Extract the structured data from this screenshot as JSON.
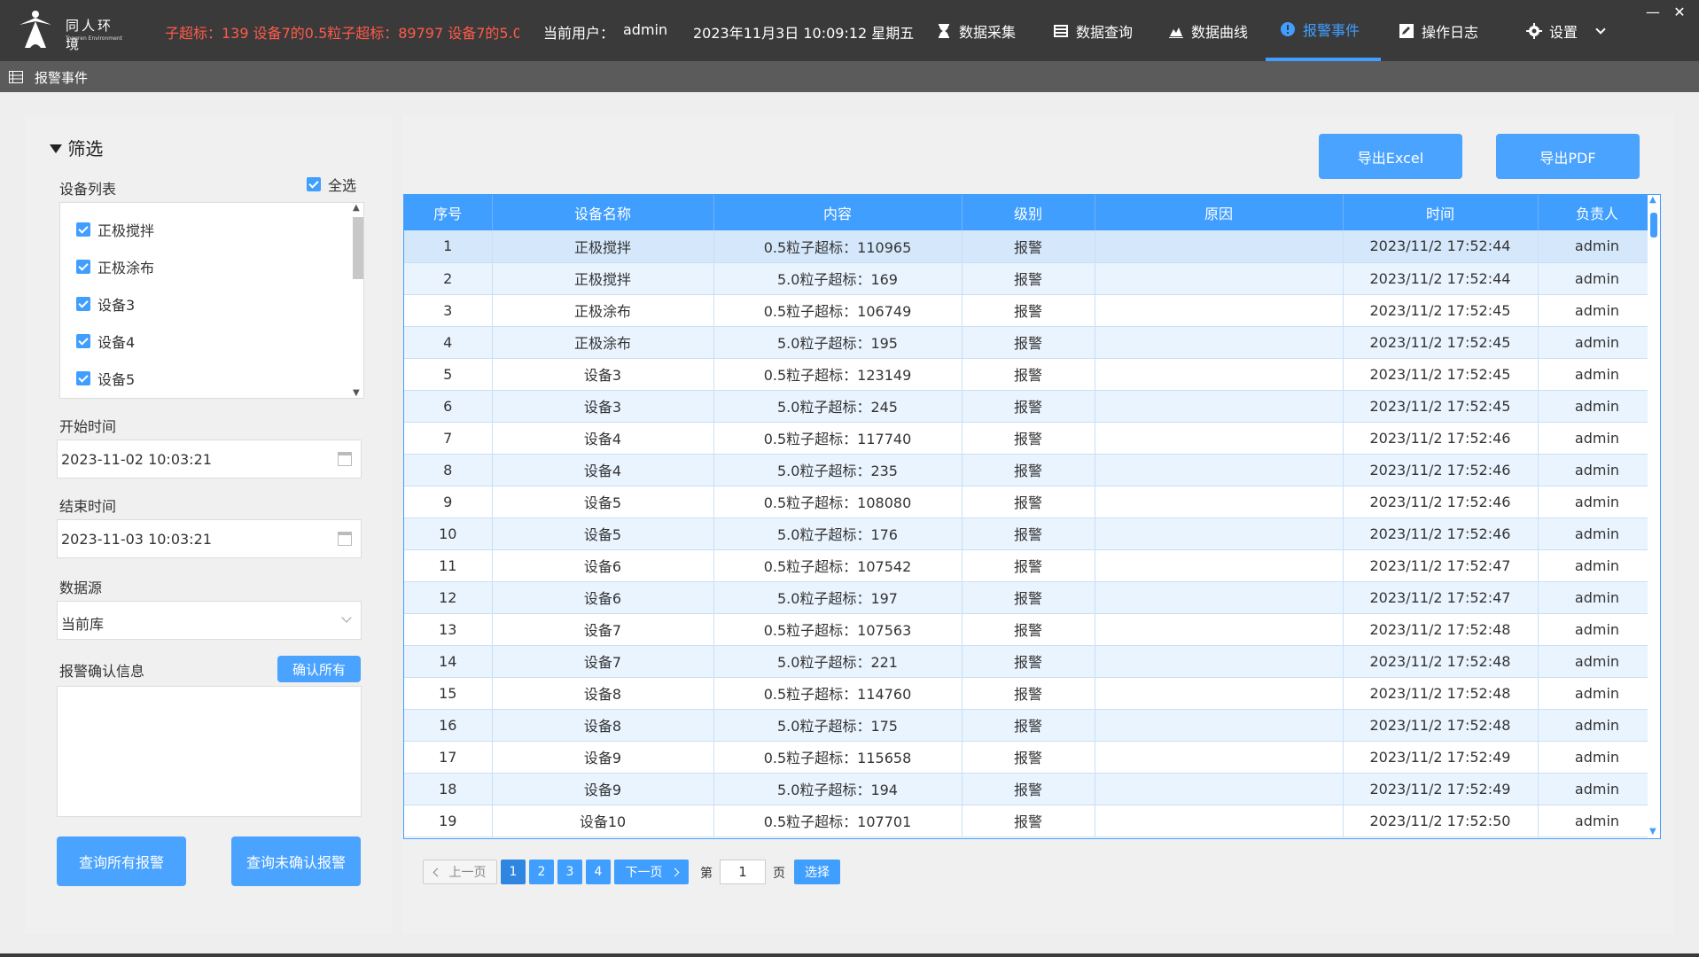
{
  "app": {
    "logo_cn": "同人环境",
    "logo_en": "Tongren Environment"
  },
  "topbar": {
    "ticker": "子超标：139   设备7的0.5粒子超标：89797   设备7的5.0",
    "user_label": "当前用户：",
    "user_name": "admin",
    "datetime": "2023年11月3日 10:09:12 星期五",
    "nav": [
      {
        "label": "数据采集",
        "icon": "hourglass-icon"
      },
      {
        "label": "数据查询",
        "icon": "table-icon"
      },
      {
        "label": "数据曲线",
        "icon": "area-chart-icon"
      },
      {
        "label": "报警事件",
        "icon": "alert-circle-icon"
      },
      {
        "label": "操作日志",
        "icon": "edit-icon"
      },
      {
        "label": "设置",
        "icon": "gear-icon"
      }
    ],
    "minimize": "—",
    "close": "✕"
  },
  "subbar": {
    "title": "报警事件"
  },
  "filter": {
    "title": "筛选",
    "device_list_label": "设备列表",
    "select_all": "全选",
    "devices": [
      "正极搅拌",
      "正极涂布",
      "设备3",
      "设备4",
      "设备5"
    ],
    "start_label": "开始时间",
    "start_value": "2023-11-02 10:03:21",
    "end_label": "结束时间",
    "end_value": "2023-11-03 10:03:21",
    "source_label": "数据源",
    "source_value": "当前库",
    "confirm_label": "报警确认信息",
    "confirm_all": "确认所有",
    "query_all": "查询所有报警",
    "query_unconfirmed": "查询未确认报警"
  },
  "actions": {
    "export_excel": "导出Excel",
    "export_pdf": "导出PDF"
  },
  "table": {
    "columns": [
      "序号",
      "设备名称",
      "内容",
      "级别",
      "原因",
      "时间",
      "负责人"
    ],
    "rows": [
      [
        "1",
        "正极搅拌",
        "0.5粒子超标：110965",
        "报警",
        "",
        "2023/11/2 17:52:44",
        "admin"
      ],
      [
        "2",
        "正极搅拌",
        "5.0粒子超标：169",
        "报警",
        "",
        "2023/11/2 17:52:44",
        "admin"
      ],
      [
        "3",
        "正极涂布",
        "0.5粒子超标：106749",
        "报警",
        "",
        "2023/11/2 17:52:45",
        "admin"
      ],
      [
        "4",
        "正极涂布",
        "5.0粒子超标：195",
        "报警",
        "",
        "2023/11/2 17:52:45",
        "admin"
      ],
      [
        "5",
        "设备3",
        "0.5粒子超标：123149",
        "报警",
        "",
        "2023/11/2 17:52:45",
        "admin"
      ],
      [
        "6",
        "设备3",
        "5.0粒子超标：245",
        "报警",
        "",
        "2023/11/2 17:52:45",
        "admin"
      ],
      [
        "7",
        "设备4",
        "0.5粒子超标：117740",
        "报警",
        "",
        "2023/11/2 17:52:46",
        "admin"
      ],
      [
        "8",
        "设备4",
        "5.0粒子超标：235",
        "报警",
        "",
        "2023/11/2 17:52:46",
        "admin"
      ],
      [
        "9",
        "设备5",
        "0.5粒子超标：108080",
        "报警",
        "",
        "2023/11/2 17:52:46",
        "admin"
      ],
      [
        "10",
        "设备5",
        "5.0粒子超标：176",
        "报警",
        "",
        "2023/11/2 17:52:46",
        "admin"
      ],
      [
        "11",
        "设备6",
        "0.5粒子超标：107542",
        "报警",
        "",
        "2023/11/2 17:52:47",
        "admin"
      ],
      [
        "12",
        "设备6",
        "5.0粒子超标：197",
        "报警",
        "",
        "2023/11/2 17:52:47",
        "admin"
      ],
      [
        "13",
        "设备7",
        "0.5粒子超标：107563",
        "报警",
        "",
        "2023/11/2 17:52:48",
        "admin"
      ],
      [
        "14",
        "设备7",
        "5.0粒子超标：221",
        "报警",
        "",
        "2023/11/2 17:52:48",
        "admin"
      ],
      [
        "15",
        "设备8",
        "0.5粒子超标：114760",
        "报警",
        "",
        "2023/11/2 17:52:48",
        "admin"
      ],
      [
        "16",
        "设备8",
        "5.0粒子超标：175",
        "报警",
        "",
        "2023/11/2 17:52:48",
        "admin"
      ],
      [
        "17",
        "设备9",
        "0.5粒子超标：115658",
        "报警",
        "",
        "2023/11/2 17:52:49",
        "admin"
      ],
      [
        "18",
        "设备9",
        "5.0粒子超标：194",
        "报警",
        "",
        "2023/11/2 17:52:49",
        "admin"
      ],
      [
        "19",
        "设备10",
        "0.5粒子超标：107701",
        "报警",
        "",
        "2023/11/2 17:52:50",
        "admin"
      ]
    ]
  },
  "pager": {
    "prev": "上一页",
    "pages": [
      "1",
      "2",
      "3",
      "4"
    ],
    "current": "1",
    "next": "下一页",
    "goto_prefix": "第",
    "goto_value": "1",
    "goto_suffix": "页",
    "goto_button": "选择"
  },
  "colors": {
    "accent": "#409eff",
    "alert_text": "#ff5a4a",
    "topbar": "#3a3a3a"
  }
}
